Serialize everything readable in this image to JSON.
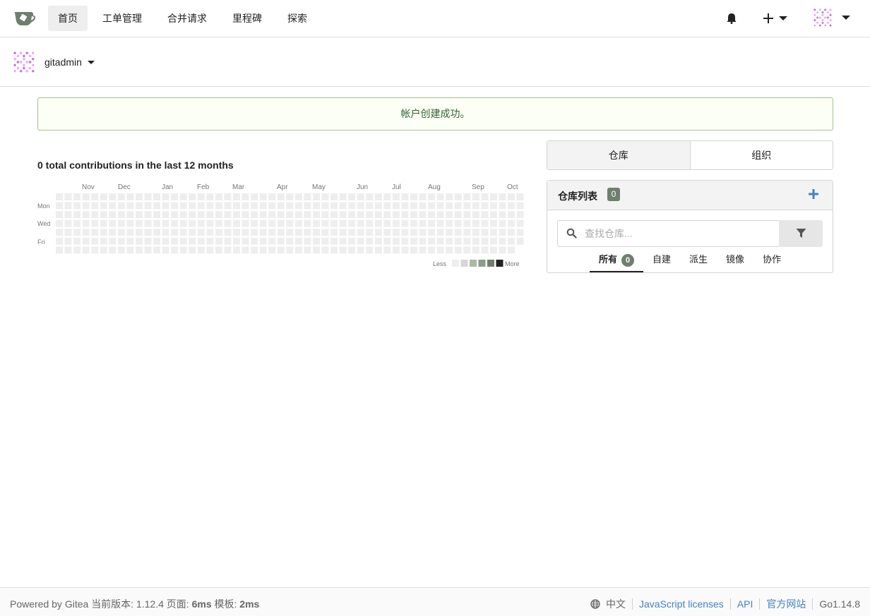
{
  "nav": {
    "items": [
      {
        "label": "首页",
        "active": true
      },
      {
        "label": "工单管理"
      },
      {
        "label": "合并请求"
      },
      {
        "label": "里程碑"
      },
      {
        "label": "探索"
      }
    ]
  },
  "user": {
    "name": "gitadmin"
  },
  "flash": {
    "message": "帐户创建成功。"
  },
  "contributions": {
    "title": "0 total contributions in the last 12 months",
    "months": [
      "Nov",
      "Dec",
      "Jan",
      "Feb",
      "Mar",
      "Apr",
      "May",
      "Jun",
      "Jul",
      "Aug",
      "Sep",
      "Oct"
    ],
    "days": [
      "Mon",
      "Wed",
      "Fri"
    ],
    "legend_less": "Less",
    "legend_more": "More",
    "scale_colors": [
      "#eeeeee",
      "#d6d6d6",
      "#a8baa0",
      "#8a9c8a",
      "#6e7f6e",
      "#222222"
    ]
  },
  "dashboard_tabs": [
    {
      "label": "仓库",
      "active": true
    },
    {
      "label": "组织"
    }
  ],
  "repo_list": {
    "title": "仓库列表",
    "count": "0",
    "search_placeholder": "查找仓库...",
    "filters": [
      {
        "label": "所有",
        "count": "0",
        "active": true
      },
      {
        "label": "自建"
      },
      {
        "label": "派生"
      },
      {
        "label": "镜像"
      },
      {
        "label": "协作"
      }
    ]
  },
  "footer": {
    "powered": "Powered by Gitea",
    "version_label": "当前版本:",
    "version": "1.12.4",
    "page_label": "页面:",
    "page_time": "6ms",
    "template_label": "模板:",
    "template_time": "2ms",
    "language": "中文",
    "links": [
      "JavaScript licenses",
      "API",
      "官方网站"
    ],
    "go_version": "Go1.14.8"
  }
}
